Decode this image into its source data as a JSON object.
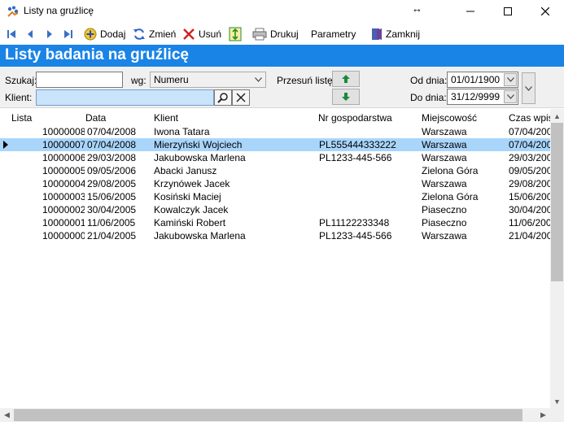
{
  "window": {
    "title": "Listy na gruźlicę",
    "resize_glyph": "↔"
  },
  "toolbar": {
    "add_label": "Dodaj",
    "edit_label": "Zmień",
    "delete_label": "Usuń",
    "print_label": "Drukuj",
    "params_label": "Parametry",
    "close_label": "Zamknij"
  },
  "header": {
    "title": "Listy badania na gruźlicę"
  },
  "filter": {
    "search_label": "Szukaj:",
    "search_value": "",
    "by_label": "wg:",
    "by_value": "Numeru",
    "move_label": "Przesuń listę:",
    "from_label": "Od dnia:",
    "from_value": "01/01/1900",
    "to_label": "Do dnia:",
    "to_value": "31/12/9999",
    "client_label": "Klient:",
    "client_value": ""
  },
  "grid": {
    "columns": [
      "Lista",
      "Data",
      "Klient",
      "Nr gospodarstwa",
      "Miejscowość",
      "Czas wpisa"
    ],
    "rows": [
      {
        "id": "10000008",
        "date": "07/04/2008",
        "client": "Iwona Tatara",
        "farm": "",
        "city": "Warszawa",
        "time": "07/04/200",
        "selected": false
      },
      {
        "id": "10000007",
        "date": "07/04/2008",
        "client": "Mierzyński Wojciech",
        "farm": "PL555444333222",
        "city": "Warszawa",
        "time": "07/04/200",
        "selected": true
      },
      {
        "id": "10000006",
        "date": "29/03/2008",
        "client": "Jakubowska Marlena",
        "farm": "PL1233-445-566",
        "city": "Warszawa",
        "time": "29/03/200",
        "selected": false
      },
      {
        "id": "10000005",
        "date": "09/05/2006",
        "client": "Abacki Janusz",
        "farm": "",
        "city": "Zielona Góra",
        "time": "09/05/200",
        "selected": false
      },
      {
        "id": "10000004",
        "date": "29/08/2005",
        "client": "Krzynówek Jacek",
        "farm": "",
        "city": "Warszawa",
        "time": "29/08/200",
        "selected": false
      },
      {
        "id": "10000003",
        "date": "15/06/2005",
        "client": "Kosiński Maciej",
        "farm": "",
        "city": "Zielona Góra",
        "time": "15/06/200",
        "selected": false
      },
      {
        "id": "10000002",
        "date": "30/04/2005",
        "client": "Kowalczyk Jacek",
        "farm": "",
        "city": "Piaseczno",
        "time": "30/04/200",
        "selected": false
      },
      {
        "id": "10000001",
        "date": "11/06/2005",
        "client": "Kamiński Robert",
        "farm": "PL11122233348",
        "city": "Piaseczno",
        "time": "11/06/200",
        "selected": false
      },
      {
        "id": "10000000",
        "date": "21/04/2005",
        "client": "Jakubowska Marlena",
        "farm": "PL1233-445-566",
        "city": "Warszawa",
        "time": "21/04/200",
        "selected": false
      }
    ]
  },
  "colors": {
    "header_bg": "#1a83e6",
    "selection": "#a9d5fb",
    "nav_icon": "#3b6fc4"
  }
}
